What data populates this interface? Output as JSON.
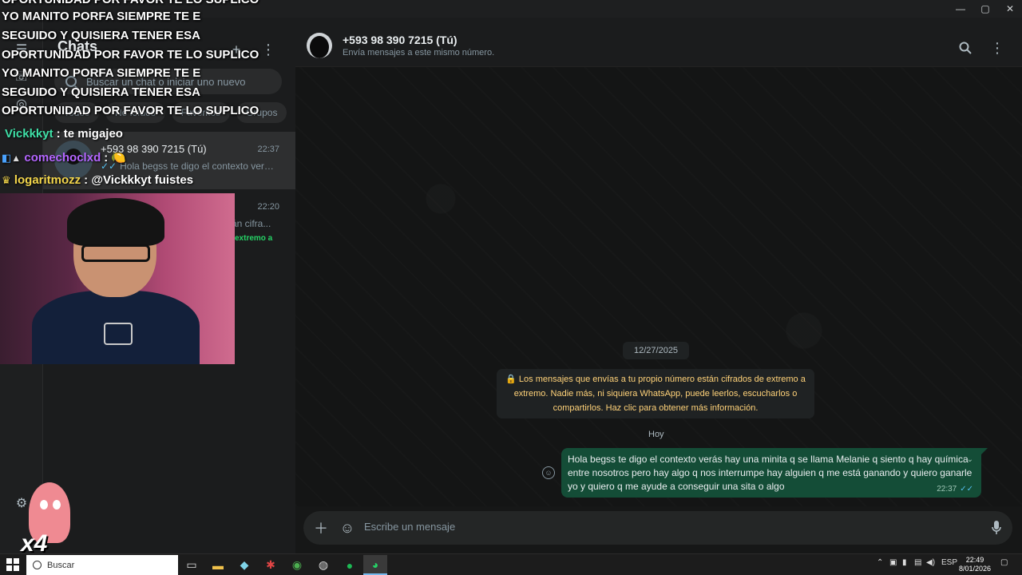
{
  "window": {
    "minimize": "—",
    "maximize": "▢",
    "close": "✕"
  },
  "sidebar_panel": {
    "title": "Chats",
    "new_chat": "+",
    "menu": "⋮",
    "search_placeholder": "Buscar un chat o iniciar uno nuevo",
    "filters": [
      "Todos",
      "No leídos",
      "Favoritos",
      "Grupos"
    ],
    "chats": [
      {
        "name": "+593 98 390 7215 (Tú)",
        "time": "22:37",
        "preview": "Hola begss te digo el contexto verás ..."
      },
      {
        "name": "",
        "time": "22:20",
        "preview": "án cifra..."
      }
    ],
    "snippet": "extremo a"
  },
  "conversation": {
    "contact_name": "+593 98 390 7215 (Tú)",
    "contact_status": "Envía mensajes a este mismo número.",
    "date_label": "12/27/2025",
    "encryption_notice": "🔒 Los mensajes que envías a tu propio número están cifrados de extremo a extremo. Nadie más, ni siquiera WhatsApp, puede leerlos, escucharlos o compartirlos. Haz clic para obtener más información.",
    "today_label": "Hoy",
    "message": {
      "text": "Hola begss te digo el contexto verás hay una minita q se llama Melanie q siento q hay química entre nosotros  pero hay algo q nos interrumpe hay alguien q me está ganando  y quiero ganarle yo y quiero q me ayude a conseguir una sita o algo",
      "time": "22:37",
      "ticks": "✓✓"
    },
    "composer_placeholder": "Escribe un mensaje"
  },
  "overlay": {
    "title_lines": [
      "OPORTUNIDAD POR FAVOR TE LO SUPLICO",
      "YO MANITO PORFA SIEMPRE TE E",
      "SEGUIDO Y QUISIERA TENER ESA",
      "OPORTUNIDAD POR FAVOR TE LO SUPLICO",
      "YO MANITO PORFA SIEMPRE TE E",
      "SEGUIDO Y QUISIERA TENER ESA",
      "OPORTUNIDAD POR FAVOR TE LO SUPLICO"
    ],
    "chat": [
      {
        "user": "Vickkkyt",
        "text": ": te migajeo",
        "color": "#3fe0a7"
      },
      {
        "user": "comechoclxd",
        "text": ": 🍋",
        "color": "#b466ff"
      },
      {
        "user": "logaritmozz",
        "text": ": @Vickkkyt fuistes",
        "color": "#f2d54b"
      }
    ],
    "multiplier": "x4"
  },
  "taskbar": {
    "search_label": "Buscar",
    "lang": "ESP",
    "time": "22:49",
    "date": "8/01/2026"
  },
  "colors": {
    "accent": "#25d366",
    "bubble": "#144d37",
    "notice": "#ffd279"
  }
}
